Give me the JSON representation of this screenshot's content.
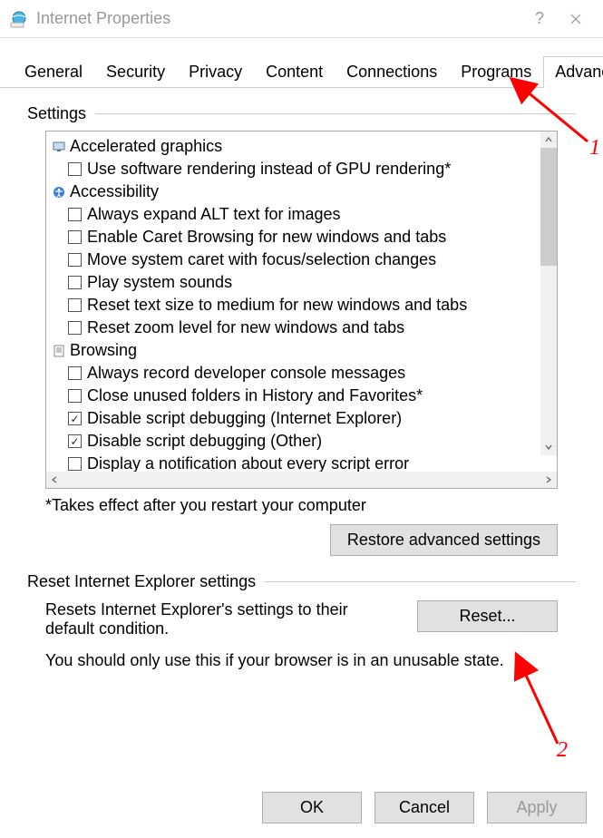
{
  "window": {
    "title": "Internet Properties"
  },
  "tabs": {
    "items": [
      {
        "label": "General"
      },
      {
        "label": "Security"
      },
      {
        "label": "Privacy"
      },
      {
        "label": "Content"
      },
      {
        "label": "Connections"
      },
      {
        "label": "Programs"
      },
      {
        "label": "Advanced"
      }
    ],
    "active": "Advanced"
  },
  "settings": {
    "label": "Settings",
    "categories": [
      {
        "icon": "monitor-icon",
        "label": "Accelerated graphics",
        "items": [
          {
            "checked": false,
            "label": "Use software rendering instead of GPU rendering*"
          }
        ]
      },
      {
        "icon": "accessibility-icon",
        "label": "Accessibility",
        "items": [
          {
            "checked": false,
            "label": "Always expand ALT text for images"
          },
          {
            "checked": false,
            "label": "Enable Caret Browsing for new windows and tabs"
          },
          {
            "checked": false,
            "label": "Move system caret with focus/selection changes"
          },
          {
            "checked": false,
            "label": "Play system sounds"
          },
          {
            "checked": false,
            "label": "Reset text size to medium for new windows and tabs"
          },
          {
            "checked": false,
            "label": "Reset zoom level for new windows and tabs"
          }
        ]
      },
      {
        "icon": "page-icon",
        "label": "Browsing",
        "items": [
          {
            "checked": false,
            "label": "Always record developer console messages"
          },
          {
            "checked": false,
            "label": "Close unused folders in History and Favorites*"
          },
          {
            "checked": true,
            "label": "Disable script debugging (Internet Explorer)"
          },
          {
            "checked": true,
            "label": "Disable script debugging (Other)"
          },
          {
            "checked": false,
            "label": "Display a notification about every script error"
          }
        ]
      }
    ],
    "footnote": "*Takes effect after you restart your computer",
    "restore_button": "Restore advanced settings"
  },
  "reset": {
    "label": "Reset Internet Explorer settings",
    "desc": "Resets Internet Explorer's settings to their default condition.",
    "button": "Reset...",
    "note": "You should only use this if your browser is in an unusable state."
  },
  "dialog_buttons": {
    "ok": "OK",
    "cancel": "Cancel",
    "apply": "Apply"
  },
  "annotations": {
    "n1": "1",
    "n2": "2"
  }
}
